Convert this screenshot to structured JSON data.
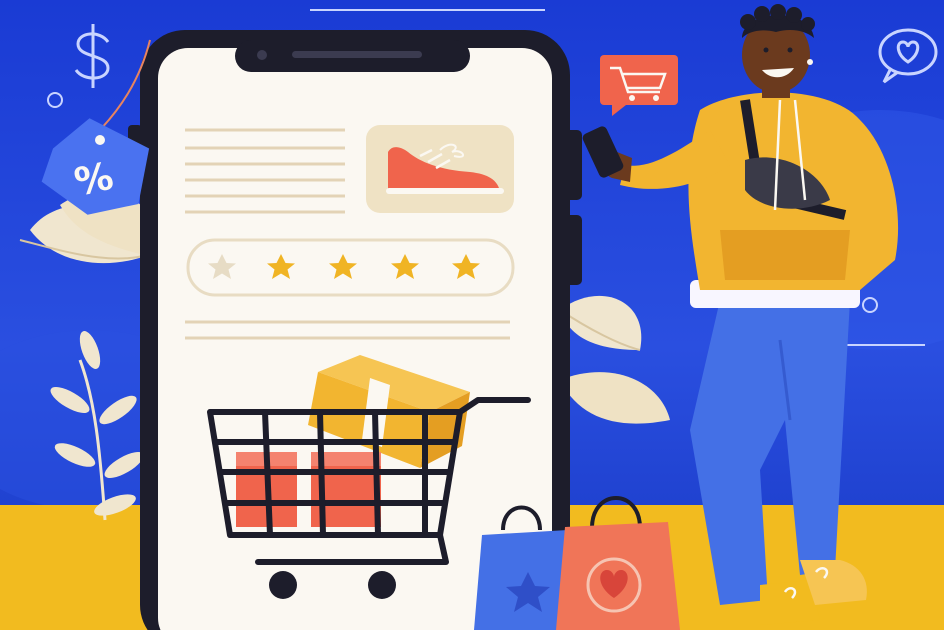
{
  "illustration": {
    "subject": "online-shopping",
    "discount_tag": {
      "text": "%"
    },
    "product_rating": {
      "filled": 4,
      "total": 5
    },
    "colors": {
      "background_blue": "#1e3fd0",
      "floor_yellow": "#f2bb1f",
      "phone_frame": "#1d1d2b",
      "phone_screen": "#fbf8f2",
      "star": "#f0b424",
      "salmon": "#f0644c",
      "hoodie": "#f2b530",
      "jeans": "#4470e6",
      "skin": "#6b3a1e"
    },
    "icons": [
      "dollar-icon",
      "heart-icon",
      "cart-bubble-icon",
      "percent-tag-icon",
      "sneaker-icon",
      "star-icon",
      "shopping-cart-icon",
      "gift-box-icon",
      "shopping-bag-icon"
    ]
  }
}
